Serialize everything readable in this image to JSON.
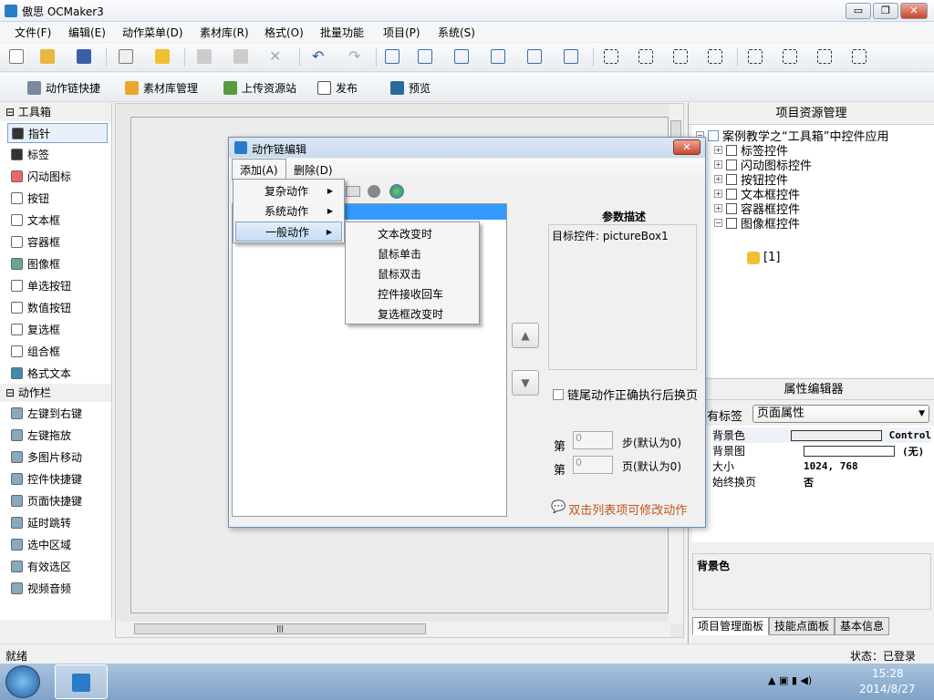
{
  "window": {
    "title": "傲思 OCMaker3",
    "minimize": "▭",
    "restore": "❐",
    "close": "✕"
  },
  "menubar": [
    "文件(F)",
    "编辑(E)",
    "动作菜单(D)",
    "素材库(R)",
    "格式(O)",
    "批量功能",
    "项目(P)",
    "系统(S)"
  ],
  "toolbar2": [
    {
      "label": "动作链快捷",
      "icon": "action-chain-icon"
    },
    {
      "label": "素材库管理",
      "icon": "library-icon"
    },
    {
      "label": "上传资源站",
      "icon": "upload-icon"
    },
    {
      "label": "发布",
      "icon": "publish-icon"
    },
    {
      "label": "预览",
      "icon": "preview-icon"
    }
  ],
  "toolbox": {
    "section1": "工具箱",
    "tools": [
      "指针",
      "标签",
      "闪动图标",
      "按钮",
      "文本框",
      "容器框",
      "图像框",
      "单选按钮",
      "数值按钮",
      "复选框",
      "组合框",
      "格式文本"
    ],
    "section2": "动作栏",
    "actions": [
      "左键到右键",
      "左键拖放",
      "多图片移动",
      "控件快捷键",
      "页面快捷键",
      "延时跳转",
      "选中区域",
      "有效选区",
      "视频音频"
    ]
  },
  "right": {
    "project_title": "项目资源管理",
    "tree_root": "案例教学之“工具箱”中控件应用",
    "tree_items": [
      "标签控件",
      "闪动图标控件",
      "按钮控件",
      "文本框控件",
      "容器框控件",
      "图像框控件"
    ],
    "tree_child": "[1]",
    "prop_title": "属性编辑器",
    "prop_label": "有标签",
    "prop_select": "页面属性",
    "props": [
      {
        "k": "背景色",
        "v": "Control"
      },
      {
        "k": "背景图",
        "v": "(无)"
      },
      {
        "k": "大小",
        "v": "1024, 768"
      },
      {
        "k": "始终换页",
        "v": "否"
      }
    ],
    "desc_title": "背景色",
    "tabs": [
      "项目管理面板",
      "技能点面板",
      "基本信息"
    ]
  },
  "dialog": {
    "title": "动作链编辑",
    "menu": [
      "添加(A)",
      "删除(D)"
    ],
    "add_menu": [
      "复杂动作",
      "系统动作",
      "一般动作"
    ],
    "sub_menu": [
      "文本改变时",
      "鼠标单击",
      "鼠标双击",
      "控件接收回车",
      "复选框改变时"
    ],
    "param_title": "参数描述",
    "param_text": "目标控件: pictureBox1",
    "checkbox_label": "链尾动作正确执行后换页",
    "step_prefix": "第",
    "step_value": "0",
    "step_suffix": "步(默认为0)",
    "page_prefix": "第",
    "page_value": "0",
    "page_suffix": "页(默认为0)",
    "hint": "双击列表项可修改动作",
    "hint_color": "#c0561b"
  },
  "status": {
    "left": "就绪",
    "right": "状态：已登录"
  },
  "taskbar": {
    "time": "15:28",
    "date": "2014/8/27"
  }
}
